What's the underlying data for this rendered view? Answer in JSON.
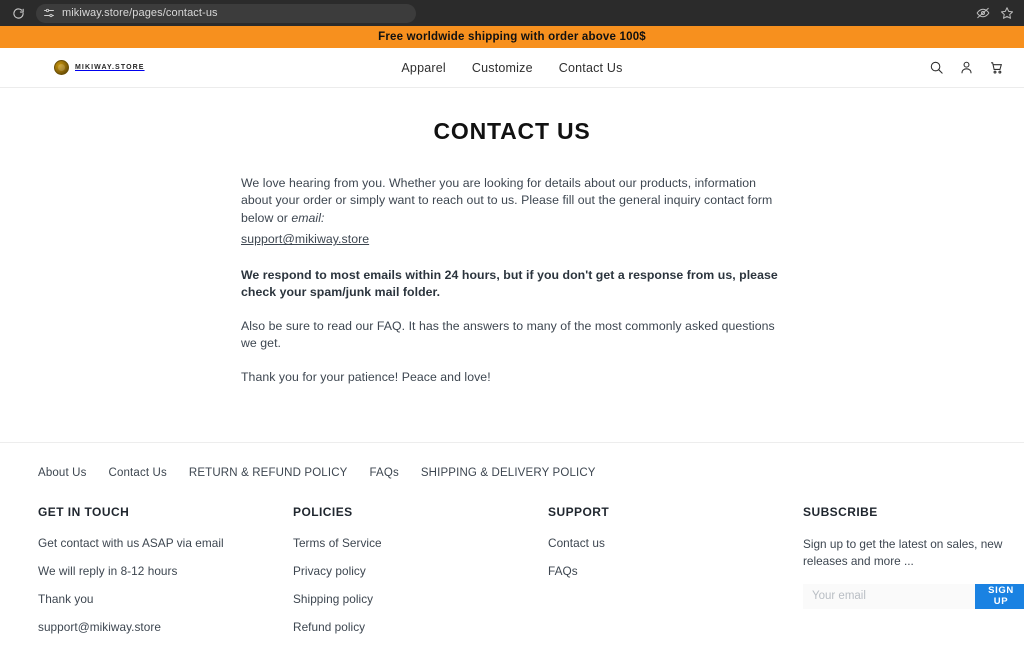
{
  "browser": {
    "reload_icon": "reload-icon",
    "tune_icon": "tune-sliders-icon",
    "url": "mikiway.store/pages/contact-us",
    "eye_off_icon": "eye-off-icon",
    "bookmark_icon": "star-bookmark-icon"
  },
  "announcement": {
    "text": "Free worldwide shipping with order above 100$",
    "background_color": "#f7901e",
    "text_color": "#111111"
  },
  "header": {
    "logo_text": "MIKIWAY.STORE",
    "logo_mark_icon": "circular-logo-icon",
    "nav": [
      {
        "label": "Apparel"
      },
      {
        "label": "Customize"
      },
      {
        "label": "Contact Us"
      }
    ],
    "icons": [
      {
        "name": "search-icon"
      },
      {
        "name": "account-user-icon"
      },
      {
        "name": "shopping-cart-icon"
      }
    ]
  },
  "main": {
    "title": "CONTACT US",
    "paragraph_intro": "We love hearing from you. Whether you are looking for details about our products, information about your order or simply want to reach out to us. Please fill out the general inquiry contact form below or ",
    "paragraph_intro_italic": "email:",
    "email_link": "support@mikiway.store",
    "paragraph_bold": "We respond to most emails within 24 hours, but if you don't get a response from us, please check your spam/junk mail folder.",
    "paragraph_faq": "Also be sure to read our FAQ. It has the answers to many of the most commonly asked questions we get.",
    "paragraph_thanks": "Thank you for your patience! Peace and love!"
  },
  "footer": {
    "nav": [
      {
        "label": "About Us"
      },
      {
        "label": "Contact Us"
      },
      {
        "label": "RETURN & REFUND POLICY"
      },
      {
        "label": "FAQs"
      },
      {
        "label": "SHIPPING & DELIVERY POLICY"
      }
    ],
    "columns": {
      "get_in_touch": {
        "title": "GET IN TOUCH",
        "items": [
          "Get contact with us ASAP via email",
          "We will reply in 8-12 hours",
          "Thank you",
          "support@mikiway.store"
        ]
      },
      "policies": {
        "title": "POLICIES",
        "items": [
          "Terms of Service",
          "Privacy policy",
          "Shipping policy",
          "Refund policy"
        ]
      },
      "support": {
        "title": "SUPPORT",
        "items": [
          "Contact us",
          "FAQs"
        ]
      },
      "subscribe": {
        "title": "SUBSCRIBE",
        "description": "Sign up to get the latest on sales, new releases and more ...",
        "input_placeholder": "Your email",
        "input_value": "",
        "button_label": "SIGN UP",
        "button_color": "#1a82e2"
      }
    }
  }
}
